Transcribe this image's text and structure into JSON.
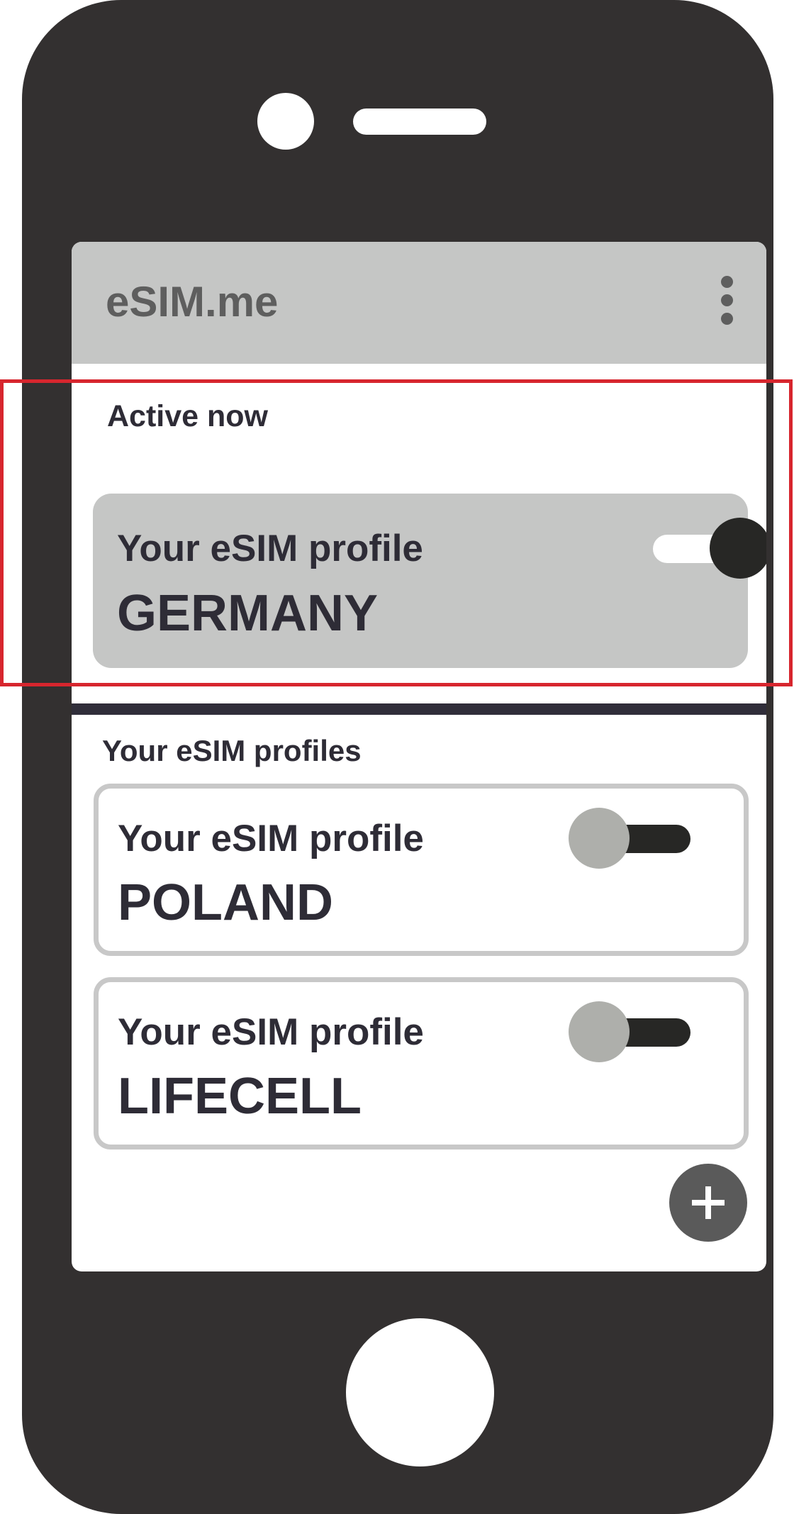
{
  "app": {
    "title": "eSIM.me",
    "menu_icon": "more-vertical-icon"
  },
  "active_section": {
    "label": "Active now",
    "profile": {
      "subtitle": "Your eSIM profile",
      "name": "GERMANY",
      "enabled": true
    }
  },
  "profiles_section": {
    "label": "Your eSIM profiles",
    "profiles": [
      {
        "subtitle": "Your eSIM profile",
        "name": "POLAND",
        "enabled": false
      },
      {
        "subtitle": "Your eSIM profile",
        "name": "LIFECELL",
        "enabled": false
      }
    ]
  },
  "add_button": {
    "icon": "plus-icon"
  },
  "colors": {
    "phone_body": "#333030",
    "app_bar": "#c5c6c5",
    "text_dark": "#2e2c36",
    "highlight": "#d7262e",
    "fab": "#5a5a5a"
  }
}
